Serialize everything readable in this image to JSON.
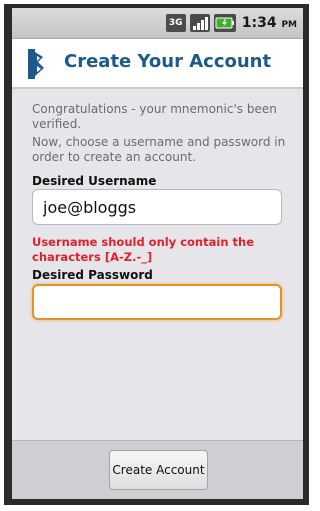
{
  "status_bar": {
    "network_label": "3G",
    "time": "1:34",
    "ampm": "PM",
    "icons": [
      "network-3g-icon",
      "signal-strength-icon",
      "battery-icon"
    ]
  },
  "header": {
    "title": "Create Your Account",
    "logo_icon": "app-logo-icon",
    "title_color": "#1d5a8c"
  },
  "form": {
    "intro_message": "Congratulations - your mnemonic's been verified.",
    "instruction_message": "Now, choose a username and password in order to create an account.",
    "username_label": "Desired Username",
    "username_value": "joe@bloggs",
    "error_message": "Username should only contain the characters [A-Z.-_]",
    "error_color": "#e0202a",
    "password_label": "Desired Password",
    "password_value": "",
    "focus_color": "#e3922b"
  },
  "footer": {
    "submit_label": "Create Account"
  }
}
